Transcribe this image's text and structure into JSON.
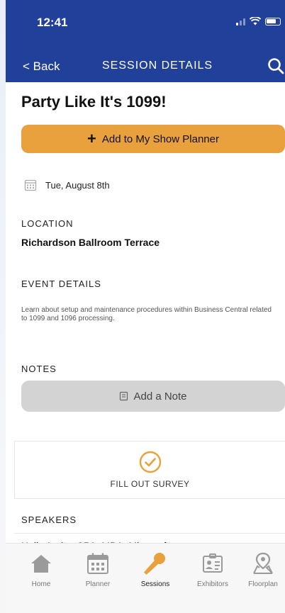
{
  "status_bar": {
    "time": "12:41"
  },
  "nav": {
    "back_label": "< Back",
    "title": "SESSION DETAILS"
  },
  "session": {
    "title": "Party Like It's 1099!",
    "add_to_planner_label": "Add to My Show Planner",
    "date": "Tue, August 8th",
    "location_label": "LOCATION",
    "location": "Richardson Ballroom Terrace",
    "event_details_label": "EVENT DETAILS",
    "event_details": "Learn about setup and maintenance procedures within Business Central related to 1099 and 1096 processing.",
    "notes_label": "NOTES",
    "add_note_label": "Add a Note",
    "survey_label": "FILL OUT SURVEY",
    "speakers_label": "SPEAKERS",
    "speaker_peek": "Holly Arnitz, CPA, MBA, Microsoft"
  },
  "tabs": [
    {
      "label": "Home",
      "icon": "home-icon"
    },
    {
      "label": "Planner",
      "icon": "calendar-icon"
    },
    {
      "label": "Sessions",
      "icon": "microphone-icon",
      "active": true
    },
    {
      "label": "Exhibitors",
      "icon": "badge-icon"
    },
    {
      "label": "Floorplan",
      "icon": "map-pin-icon"
    }
  ],
  "colors": {
    "header": "#21409a",
    "accent": "#e8a13c",
    "note_button": "#d3d3d3",
    "tab_inactive": "#9a9a9a"
  }
}
